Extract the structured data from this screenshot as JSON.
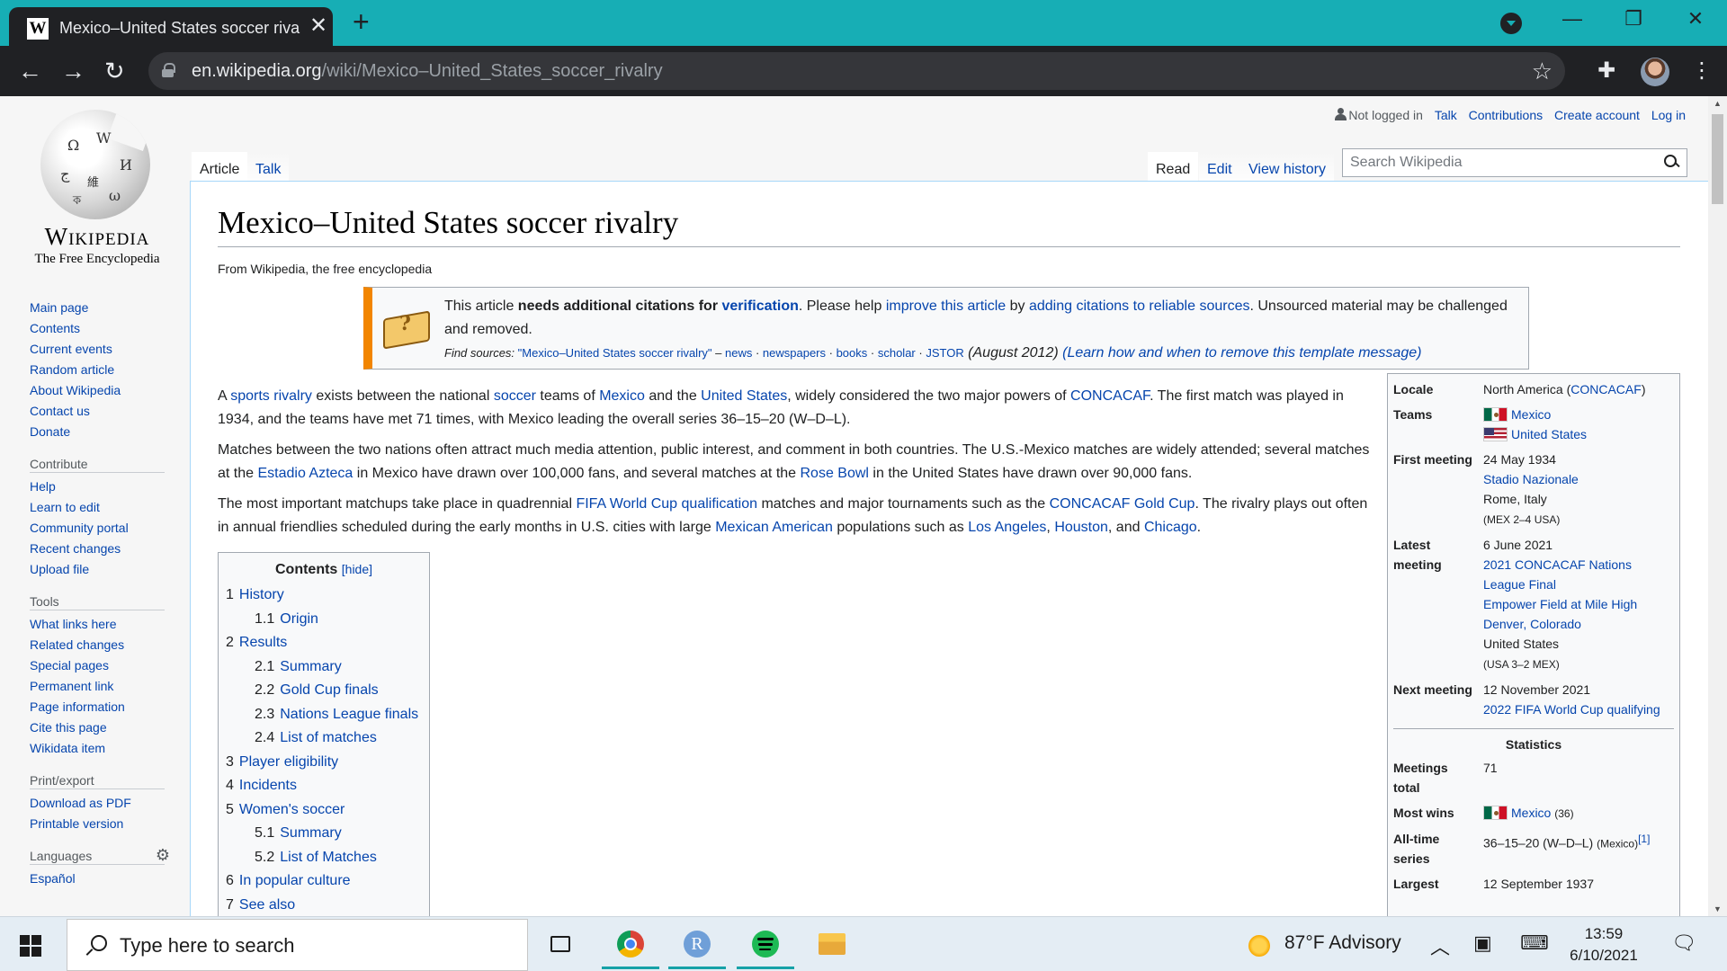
{
  "browser": {
    "tab_title": "Mexico–United States soccer rivalry - Wikipedia",
    "tab_favicon": "W",
    "url_host": "en.wikipedia.org",
    "url_path": "/wiki/Mexico–United_States_soccer_rivalry"
  },
  "logo": {
    "wordmark": "Wikipedia",
    "tagline": "The Free Encyclopedia"
  },
  "sidebar": {
    "nav": [
      "Main page",
      "Contents",
      "Current events",
      "Random article",
      "About Wikipedia",
      "Contact us",
      "Donate"
    ],
    "contribute_heading": "Contribute",
    "contribute": [
      "Help",
      "Learn to edit",
      "Community portal",
      "Recent changes",
      "Upload file"
    ],
    "tools_heading": "Tools",
    "tools": [
      "What links here",
      "Related changes",
      "Special pages",
      "Permanent link",
      "Page information",
      "Cite this page",
      "Wikidata item"
    ],
    "print_heading": "Print/export",
    "print": [
      "Download as PDF",
      "Printable version"
    ],
    "languages_heading": "Languages",
    "languages": [
      "Español"
    ]
  },
  "personal": {
    "not_logged_in": "Not logged in",
    "talk": "Talk",
    "contributions": "Contributions",
    "create_account": "Create account",
    "log_in": "Log in"
  },
  "tabs": {
    "article": "Article",
    "talk": "Talk",
    "read": "Read",
    "edit": "Edit",
    "view_history": "View history"
  },
  "search": {
    "placeholder": "Search Wikipedia"
  },
  "article": {
    "title": "Mexico–United States soccer rivalry",
    "site_sub": "From Wikipedia, the free encyclopedia",
    "ambox": {
      "t1": "This article ",
      "t2": "needs additional citations for ",
      "t3": "verification",
      "t4": ". Please help ",
      "t5": "improve this article",
      "t6": " by ",
      "t7": "adding citations to reliable sources",
      "t8": ". Unsourced material may be challenged and removed.",
      "fs_label": "Find sources: ",
      "fs_query": "\"Mexico–United States soccer rivalry\"",
      "fs_dash": " – ",
      "fs_news": "news",
      "fs_newspapers": "newspapers",
      "fs_books": "books",
      "fs_scholar": "scholar",
      "fs_jstor": "JSTOR",
      "date": " (August 2012) ",
      "learn": "(Learn how and when to remove this template message)"
    },
    "p1": {
      "a": "A ",
      "l1": "sports rivalry",
      "b": " exists between the national ",
      "l2": "soccer",
      "c": " teams of ",
      "l3": "Mexico",
      "d": " and the ",
      "l4": "United States",
      "e": ", widely considered the two major powers of ",
      "l5": "CONCACAF",
      "f": ". The first match was played in 1934, and the teams have met 71 times, with Mexico leading the overall series 36–15–20 (W–D–L)."
    },
    "p2": {
      "a": "Matches between the two nations often attract much media attention, public interest, and comment in both countries. The U.S.-Mexico matches are widely attended; several matches at the ",
      "l1": "Estadio Azteca",
      "b": " in Mexico have drawn over 100,000 fans, and several matches at the ",
      "l2": "Rose Bowl",
      "c": " in the United States have drawn over 90,000 fans."
    },
    "p3": {
      "a": "The most important matchups take place in quadrennial ",
      "l1": "FIFA World Cup qualification",
      "b": " matches and major tournaments such as the ",
      "l2": "CONCACAF Gold Cup",
      "c": ". The rivalry plays out often in annual friendlies scheduled during the early months in U.S. cities with large ",
      "l3": "Mexican American",
      "d": " populations such as ",
      "l4": "Los Angeles",
      "e": ", ",
      "l5": "Houston",
      "f": ", and ",
      "l6": "Chicago",
      "g": "."
    }
  },
  "toc": {
    "title": "Contents",
    "hide": "[hide]",
    "items": [
      {
        "num": "1",
        "label": "History"
      },
      {
        "num": "1.1",
        "label": "Origin"
      },
      {
        "num": "2",
        "label": "Results"
      },
      {
        "num": "2.1",
        "label": "Summary"
      },
      {
        "num": "2.2",
        "label": "Gold Cup finals"
      },
      {
        "num": "2.3",
        "label": "Nations League finals"
      },
      {
        "num": "2.4",
        "label": "List of matches"
      },
      {
        "num": "3",
        "label": "Player eligibility"
      },
      {
        "num": "4",
        "label": "Incidents"
      },
      {
        "num": "5",
        "label": "Women's soccer"
      },
      {
        "num": "5.1",
        "label": "Summary"
      },
      {
        "num": "5.2",
        "label": "List of Matches"
      },
      {
        "num": "6",
        "label": "In popular culture"
      },
      {
        "num": "7",
        "label": "See also"
      }
    ]
  },
  "infobox": {
    "locale_label": "Locale",
    "locale_a": "North America (",
    "locale_link": "CONCACAF",
    "locale_b": ")",
    "teams_label": "Teams",
    "team1": "Mexico",
    "team2": "United States",
    "first_label": "First meeting",
    "first_date": "24 May 1934",
    "first_venue": "Stadio Nazionale",
    "first_city": "Rome, Italy",
    "first_score": "(MEX 2–4 USA)",
    "latest_label": "Latest meeting",
    "latest_date": "6 June 2021",
    "latest_event": "2021 CONCACAF Nations League Final",
    "latest_venue": "Empower Field at Mile High",
    "latest_city": "Denver, Colorado",
    "latest_country": "United States",
    "latest_score": "(USA 3–2 MEX)",
    "next_label": "Next meeting",
    "next_date": "12 November 2021",
    "next_event": "2022 FIFA World Cup qualifying",
    "stats_heading": "Statistics",
    "meetings_label": "Meetings total",
    "meetings": "71",
    "most_wins_label": "Most wins",
    "most_wins_team": "Mexico",
    "most_wins_count": "(36)",
    "alltime_label": "All-time series",
    "alltime": "36–15–20 (W–D–L)",
    "alltime_note": "(Mexico)",
    "alltime_ref": "[1]",
    "largest_label": "Largest",
    "largest_date": "12 September 1937"
  },
  "taskbar": {
    "search_placeholder": "Type here to search",
    "weather": "87°F  Advisory",
    "time": "13:59",
    "date": "6/10/2021"
  }
}
